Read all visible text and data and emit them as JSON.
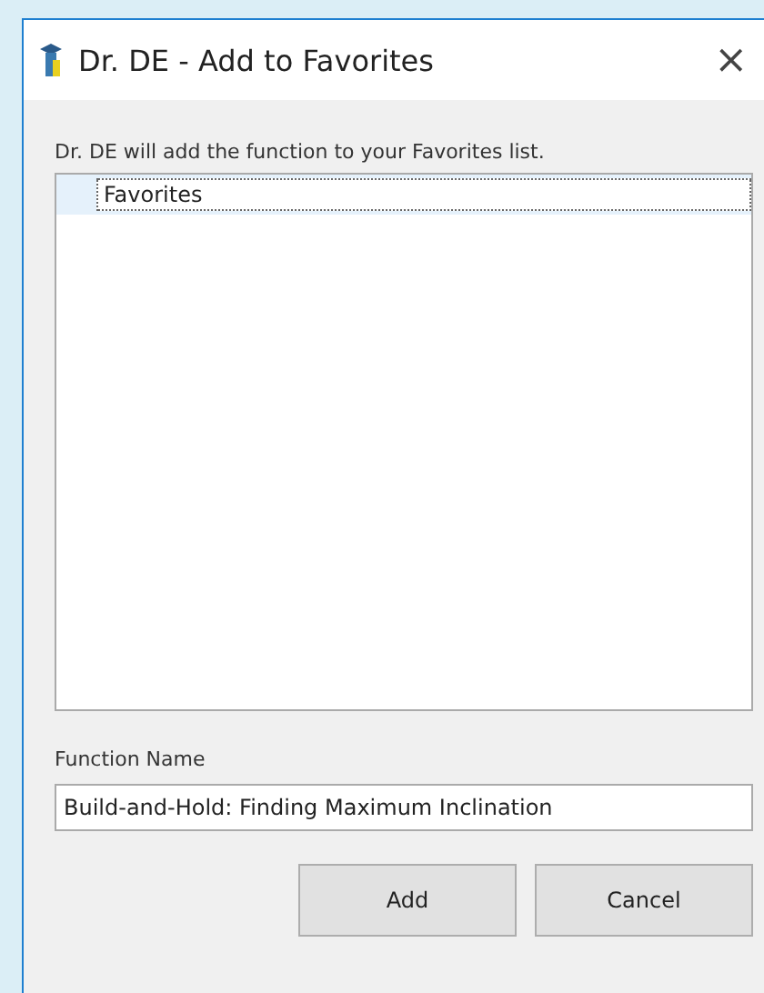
{
  "window": {
    "title": "Dr. DE - Add to Favorites",
    "close": "×"
  },
  "description": "Dr. DE will add the function to your Favorites list.",
  "tree": {
    "items": [
      {
        "label": "Favorites",
        "selected": true
      }
    ]
  },
  "function_name": {
    "label": "Function Name",
    "value": "Build-and-Hold: Finding Maximum Inclination"
  },
  "buttons": [
    "Add",
    "Cancel"
  ]
}
